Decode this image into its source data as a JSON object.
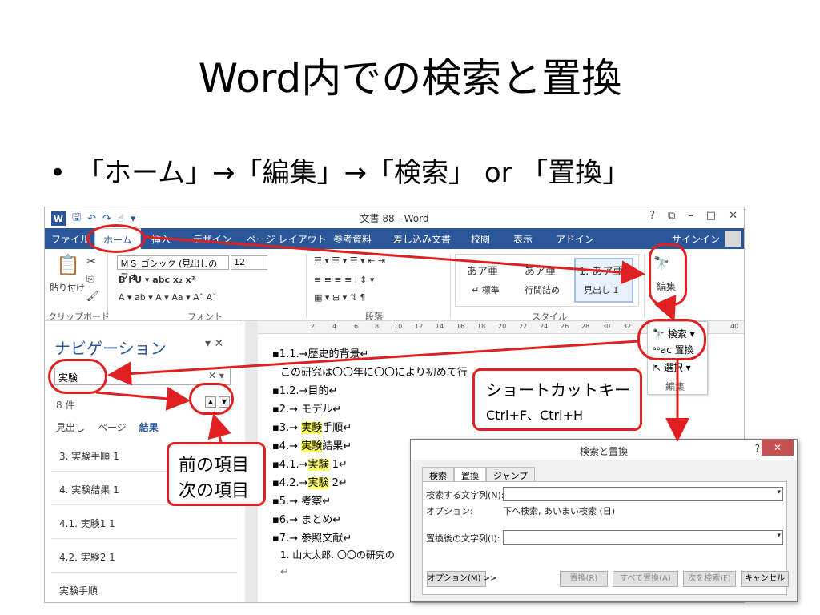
{
  "slide": {
    "title": "Word内での検索と置換",
    "bullet": "「ホーム」→「編集」→「検索」 or 「置換」"
  },
  "word": {
    "doc_title": "文書 88 - Word",
    "qat": {
      "save": "🖫",
      "undo": "↶",
      "redo": "↷",
      "touch": "☝",
      "more": "▾"
    },
    "window_controls": [
      "?",
      "⧉",
      "–",
      "□",
      "✕"
    ],
    "tabs": [
      "ファイル",
      "ホーム",
      "挿入",
      "デザイン",
      "ページ レイアウト",
      "参考資料",
      "差し込み文書",
      "校閲",
      "表示",
      "アドイン"
    ],
    "signin": "サインイン",
    "ribbon": {
      "paste_label": "貼り付け",
      "font_name": "ＭＳ ゴシック (見出しのフォ",
      "font_size": "12",
      "format_row": "B  I  U ▾ abc  x₂  x²",
      "font_row2": "A ▾  ab ▾  A ▾  Aa ▾   A˄  A˅",
      "para_row1": "☰ ▾  ☰ ▾  ☰ ▾   ⇤  ⇥",
      "para_row2": "≡  ≡  ≡  ≡  ⫶   ↕ ▾",
      "para_row3": "▦ ▾  ⊞ ▾   ⇅   ¶",
      "styles": [
        "あア亜",
        "あア亜",
        "1. あア亜"
      ],
      "style_names": [
        "↵ 標準",
        "行間詰め",
        "見出し 1"
      ],
      "edit_label": "編集",
      "groups": [
        "クリップボード",
        "フォント",
        "段落",
        "スタイル"
      ]
    },
    "nav": {
      "title": "ナビゲーション",
      "search_value": "実験",
      "count": "8 件",
      "tabs": [
        "見出し",
        "ページ",
        "結果"
      ],
      "results": [
        "3. 実験手順 1",
        "4. 実験結果 1",
        "4.1. 実験1 1",
        "4.2. 実験2 1",
        "実験手順"
      ]
    },
    "ruler": [
      "2",
      "4",
      "6",
      "8",
      "10",
      "12",
      "14",
      "16",
      "18",
      "20",
      "22",
      "24",
      "26",
      "28",
      "30",
      "32",
      "40"
    ],
    "doc": [
      {
        "pre": "▪1.1.→歴史的背景↵",
        "hl": "",
        "post": ""
      },
      {
        "pre": "この研究は〇〇年に〇〇により初めて行",
        "hl": "",
        "post": ""
      },
      {
        "pre": "▪1.2.→目的↵",
        "hl": "",
        "post": ""
      },
      {
        "pre": "▪2.→ モデル↵",
        "hl": "",
        "post": ""
      },
      {
        "pre": "▪3.→ ",
        "hl": "実験",
        "post": "手順↵"
      },
      {
        "pre": "▪4.→ ",
        "hl": "実験",
        "post": "結果↵"
      },
      {
        "pre": "▪4.1.→",
        "hl": "実験",
        "post": " 1↵"
      },
      {
        "pre": "▪4.2.→",
        "hl": "実験",
        "post": " 2↵"
      },
      {
        "pre": "▪5.→ 考察↵",
        "hl": "",
        "post": ""
      },
      {
        "pre": "▪6.→ まとめ↵",
        "hl": "",
        "post": ""
      },
      {
        "pre": "▪7.→ 参照文献↵",
        "hl": "",
        "post": ""
      },
      {
        "pre": "1.  山大太郎. 〇〇の研究の",
        "hl": "",
        "post": ""
      },
      {
        "pre": "↵",
        "hl": "",
        "post": ""
      }
    ],
    "edit_dropdown": [
      "🔭 検索 ▾",
      "ᵃᵇac 置換",
      "⇱ 選択 ▾",
      "編集"
    ]
  },
  "dialog": {
    "title": "検索と置換",
    "help": "?",
    "close": "✕",
    "tabs": [
      "検索",
      "置換",
      "ジャンプ"
    ],
    "find_label": "検索する文字列(N):",
    "options_label": "オプション:",
    "options_value": "下へ検索, あいまい検索 (日)",
    "replace_label": "置換後の文字列(I):",
    "buttons": [
      "オプション(M) >>",
      "置換(R)",
      "すべて置換(A)",
      "次を検索(F)",
      "キャンセル"
    ]
  },
  "annotations": {
    "shortcut_title": "ショートカットキー",
    "shortcut_keys": "Ctrl+F、Ctrl+H",
    "prev_item": "前の項目",
    "next_item": "次の項目"
  },
  "colors": {
    "accent": "#2b579a",
    "annotation": "#e02020",
    "highlight": "#ffff66"
  }
}
